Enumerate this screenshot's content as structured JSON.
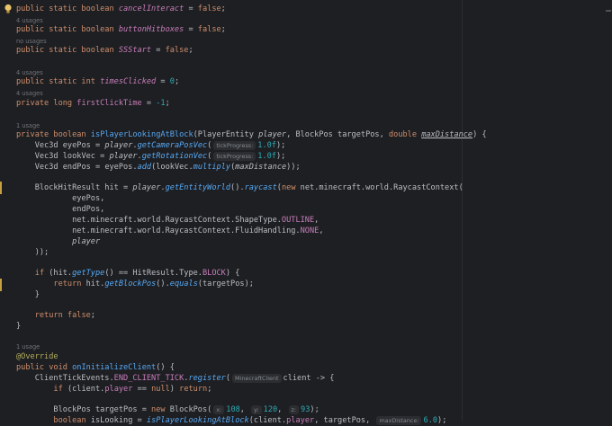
{
  "editor": {
    "usage_4": "4 usages",
    "no_usages": "no usages",
    "usage_1": "1 usage",
    "lines": {
      "l1": "public static boolean cancelInteract = false;",
      "l2": "public static boolean buttonHitboxes = false;",
      "l3": "public static boolean SSStart = false;",
      "l4": "public static int timesClicked = 0;",
      "l5": "private long firstClickTime = -1;",
      "sig": "private boolean isPlayerLookingAtBlock(PlayerEntity player, BlockPos targetPos, double maxDistance) {",
      "eye": "Vec3d eyePos = player.getCameraPosVec( 1.0f);",
      "look": "Vec3d lookVec = player.getRotationVec( 1.0f);",
      "end": "Vec3d endPos = eyePos.add(lookVec.multiply(maxDistance));",
      "hit": "BlockHitResult hit = player.getEntityWorld().raycast(new net.minecraft.world.RaycastContext(",
      "a1": "eyePos,",
      "a2": "endPos,",
      "a3": "net.minecraft.world.RaycastContext.ShapeType.OUTLINE,",
      "a4": "net.minecraft.world.RaycastContext.FluidHandling.NONE,",
      "a5": "player",
      "close1": "));",
      "if1": "if (hit.getType() == HitResult.Type.BLOCK) {",
      "ret1": "return hit.getBlockPos().equals(targetPos);",
      "brace": "}",
      "ret2": "return false;",
      "brace2": "}",
      "override": "@Override",
      "init": "public void onInitializeClient() {",
      "tick": "ClientTickEvents.END_CLIENT_TICK.register( MinecraftClient client -> {",
      "ifnull": "if (client.player == null) return;",
      "target": "BlockPos targetPos = new BlockPos( 108,  120,  93);",
      "looking": "boolean isLooking = isPlayerLookingAtBlock(client.player, targetPos,  6.0);"
    },
    "inlays": {
      "tickProgress": "tickProgress:",
      "x": "x:",
      "y": "y:",
      "z": "z:",
      "maxDistance": "maxDistance:",
      "client": "MinecraftClient"
    }
  }
}
